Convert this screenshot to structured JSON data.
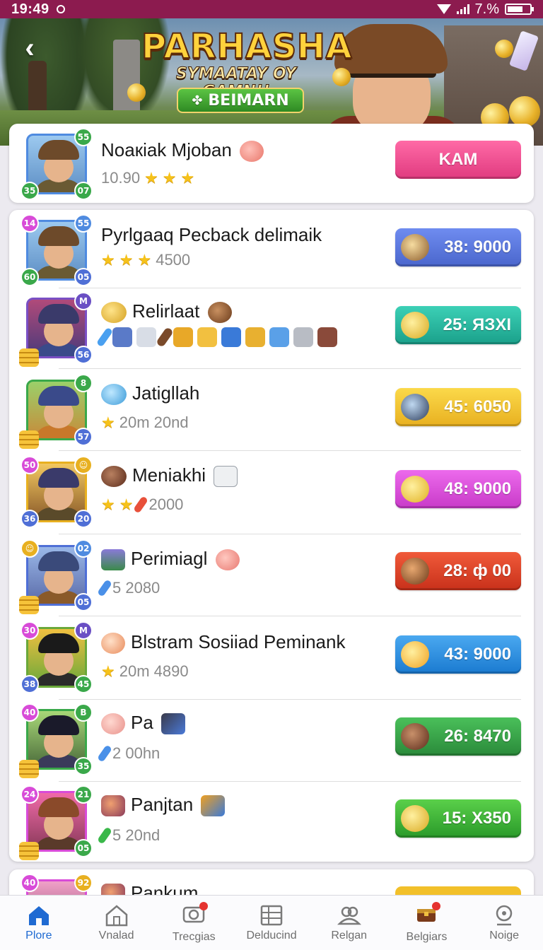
{
  "status_bar": {
    "time": "19:49",
    "battery": "7.%",
    "battery_level": 0.7
  },
  "banner": {
    "title": "PARHASHA",
    "subtitle": "SYMAATAY OY GAMN!!",
    "pill_label": "BEIMARN"
  },
  "featured": {
    "name": "Noaкiak Mjoban",
    "meta": "10.90",
    "stars": 3,
    "badges": [
      "55",
      "35",
      "07"
    ],
    "button_label": "KAM"
  },
  "rows": [
    {
      "name": "Pyrlgaaq Pecback delimaik",
      "meta": "4500",
      "stars": 3,
      "badges": [
        "14",
        "55",
        "60",
        "05"
      ],
      "button": "38: 9000",
      "color": "#4f6fd6"
    },
    {
      "name": "Relirlaat",
      "meta": "",
      "stars": 0,
      "badges": [
        "",
        "M",
        "",
        "56"
      ],
      "button": "25: ЯЗХІ",
      "color": "#24b8a0"
    },
    {
      "name": "Jatigllah",
      "meta": "20m  20nd",
      "stars": 1,
      "badges": [
        "",
        "8",
        "",
        "57"
      ],
      "button": "45: 6050",
      "color": "#f2c02a"
    },
    {
      "name": "Meniakhi",
      "meta": "2000",
      "stars": 2,
      "badges": [
        "50",
        "",
        "36",
        "20"
      ],
      "button": "48: 9000",
      "color": "#d84bd8"
    },
    {
      "name": "Perimiagl",
      "meta": "5  2080",
      "stars": 0,
      "badges": [
        "",
        "02",
        "",
        "05"
      ],
      "button": "28: ф 00",
      "color": "#e0422a"
    },
    {
      "name": "Blstram Sosiiad Peminank",
      "meta": "20m  4890",
      "stars": 1,
      "badges": [
        "30",
        "M",
        "38",
        "45"
      ],
      "button": "43: 9000",
      "color": "#2f8ee0"
    },
    {
      "name": "Pa",
      "meta": "2    00hn",
      "stars": 0,
      "badges": [
        "40",
        "B",
        "",
        "35"
      ],
      "button": "26: 8470",
      "color": "#3aa84a"
    },
    {
      "name": "Panjtan",
      "meta": "5    20nd",
      "stars": 0,
      "badges": [
        "24",
        "21",
        "",
        "05"
      ],
      "button": "15: X350",
      "color": "#45b83e"
    }
  ],
  "partial_row": {
    "name": "Pankum",
    "badges": [
      "40",
      "92"
    ]
  },
  "nav": [
    {
      "label": "Plore",
      "icon": "home-icon",
      "active": true
    },
    {
      "label": "Vnalad",
      "icon": "house-outline-icon",
      "active": false
    },
    {
      "label": "Trecgias",
      "icon": "camera-icon",
      "active": false,
      "dot": true
    },
    {
      "label": "Delducind",
      "icon": "grid-icon",
      "active": false
    },
    {
      "label": "Relgan",
      "icon": "people-icon",
      "active": false
    },
    {
      "label": "Belgiars",
      "icon": "treasure-icon",
      "active": false,
      "dot": true
    },
    {
      "label": "Noige",
      "icon": "profile-icon",
      "active": false
    }
  ]
}
